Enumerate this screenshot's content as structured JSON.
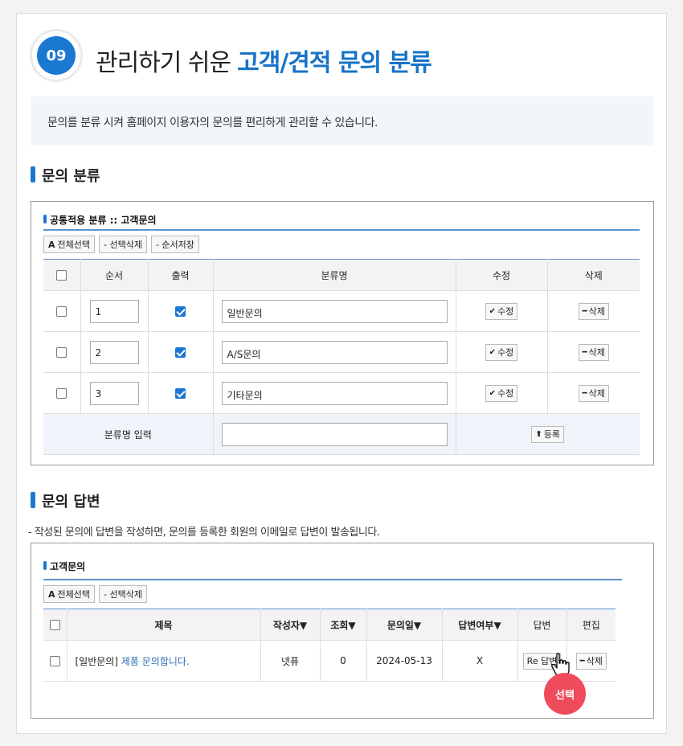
{
  "header": {
    "number": "09",
    "title_plain": "관리하기 쉬운",
    "title_highlight": "고객/견적 문의 분류"
  },
  "intro": "문의를 분류 시켜 홈페이지 이용자의 문의를 편리하게 관리할 수 있습니다.",
  "section1": {
    "heading": "문의 분류",
    "subheading": "공통적용 분류 :: 고객문의",
    "buttons": {
      "select_all": "전체선택",
      "select_all_prefix": "A",
      "delete_selected": "- 선택삭제",
      "save_order": "- 순서저장"
    },
    "columns": [
      "순서",
      "출력",
      "분류명",
      "수정",
      "삭제"
    ],
    "rows": [
      {
        "order": "1",
        "name": "일반문의"
      },
      {
        "order": "2",
        "name": "A/S문의"
      },
      {
        "order": "3",
        "name": "기타문의"
      }
    ],
    "edit_label": "수정",
    "delete_label": "삭제",
    "add_row_label": "분류명 입력",
    "register_label": "등록"
  },
  "section2": {
    "heading": "문의 답변",
    "note": "-  작성된 문의에 답변을 작성하면, 문의를 등록한 회원의 이메일로 답변이 발송됩니다.",
    "subheading": "고객문의",
    "buttons": {
      "select_all": "전체선택",
      "select_all_prefix": "A",
      "delete_selected": "- 선택삭제"
    },
    "columns": [
      "제목",
      "작성자▼",
      "조회▼",
      "문의일▼",
      "답변여부▼",
      "답변",
      "편집"
    ],
    "row": {
      "category": "[일반문의]",
      "title": "제품 문의합니다.",
      "author": "넷퓨",
      "views": "0",
      "date": "2024-05-13",
      "answered": "X",
      "reply_label": "Re 답변",
      "delete_label": "삭제"
    },
    "select_badge": "선택"
  },
  "colors": {
    "accent": "#1b78d0",
    "badge": "#ef4b5c"
  }
}
